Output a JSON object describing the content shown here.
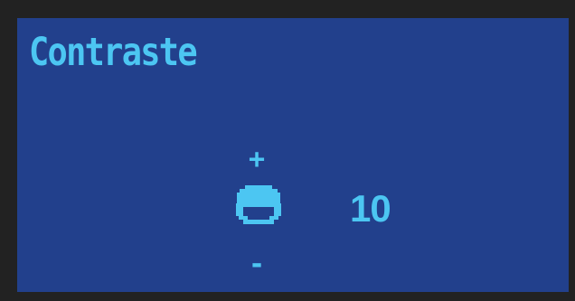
{
  "screen": {
    "title": "Contraste",
    "background_color": "#22408c",
    "accent_color": "#4cc6f2",
    "frame_color": "#222222"
  },
  "contrast_control": {
    "increase_label": "+",
    "decrease_label": "-",
    "icon": "contrast-icon",
    "value": "10"
  }
}
